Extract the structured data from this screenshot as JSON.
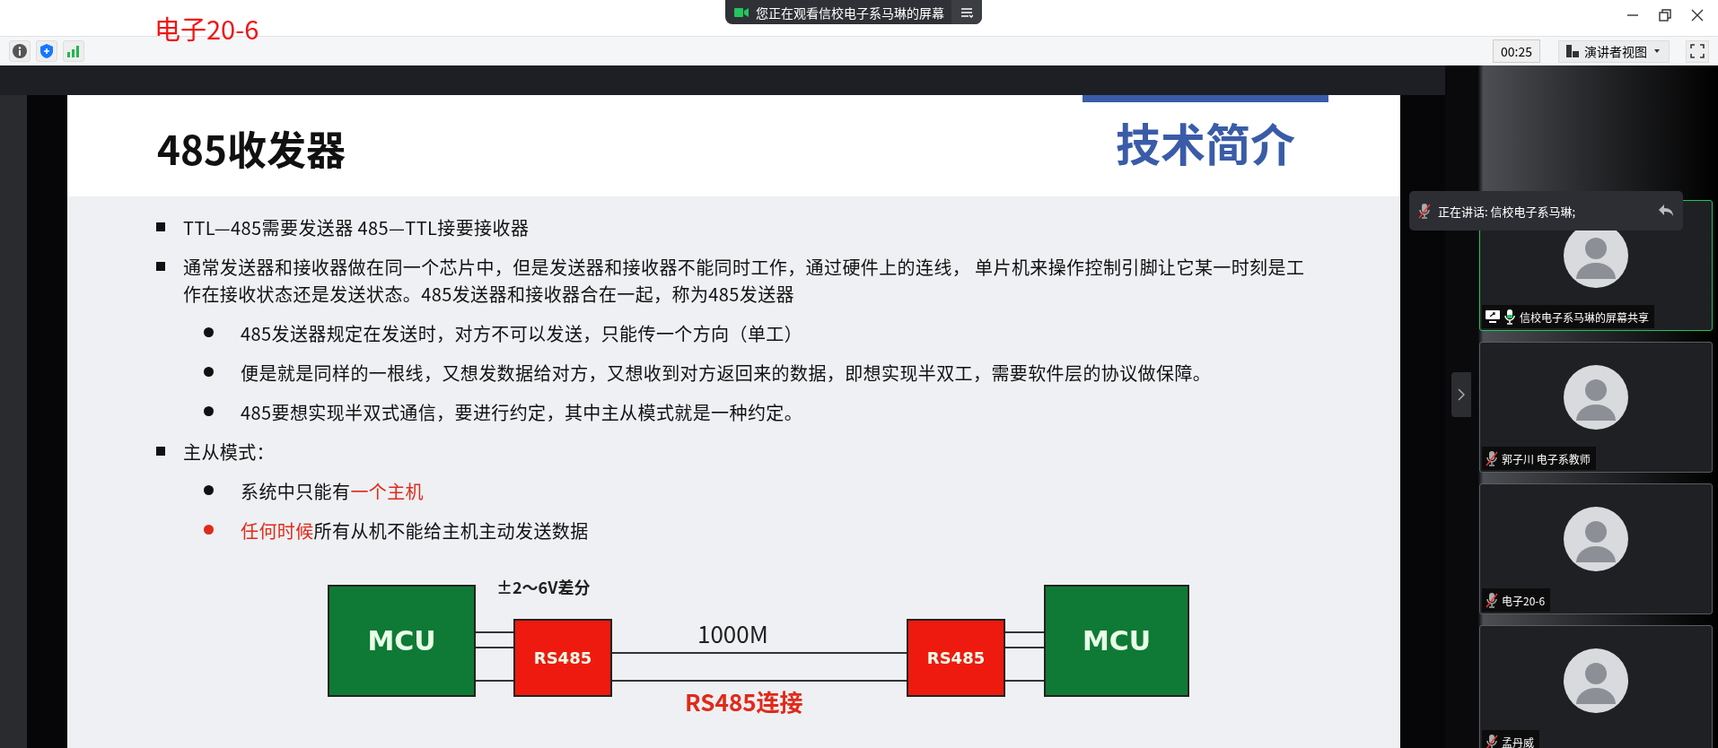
{
  "window": {
    "overlay_label": "电子20-6"
  },
  "share_notice": {
    "text": "您正在观看信校电子系马琳的屏幕"
  },
  "toolbar": {
    "timer": "00:25",
    "view_menu": "演讲者视图"
  },
  "slide": {
    "title": "485收发器",
    "section": "技术简介",
    "bullets": [
      {
        "segments": [
          {
            "text": "TTL—485需要发送器   485—TTL接要接收器",
            "highlight": false
          }
        ]
      },
      {
        "segments": [
          {
            "text": "通常发送器和接收器做在同一个芯片中，但是发送器和接收器不能同时工作，通过硬件上的连线， 单片机来操作控制引脚让它某一时刻是工作在接收状态还是发送状态。485发送器和接收器合在一起，称为485发送器",
            "highlight": false
          }
        ],
        "children": [
          {
            "marker_highlight": false,
            "segments": [
              {
                "text": " 485发送器规定在发送时，对方不可以发送，只能传一个方向（单工）",
                "highlight": false
              }
            ]
          },
          {
            "marker_highlight": false,
            "segments": [
              {
                "text": "便是就是同样的一根线，又想发数据给对方，又想收到对方返回来的数据，即想实现半双工，需要软件层的协议做保障。",
                "highlight": false
              }
            ]
          },
          {
            "marker_highlight": false,
            "segments": [
              {
                "text": "485要想实现半双式通信，要进行约定，其中主从模式就是一种约定。",
                "highlight": false
              }
            ]
          }
        ]
      },
      {
        "segments": [
          {
            "text": "主从模式：",
            "highlight": false
          }
        ],
        "children": [
          {
            "marker_highlight": false,
            "segments": [
              {
                "text": "系统中只能有",
                "highlight": false
              },
              {
                "text": "一个主机",
                "highlight": true
              }
            ]
          },
          {
            "marker_highlight": true,
            "segments": [
              {
                "text": "任何时候",
                "highlight": true
              },
              {
                "text": "所有从机不能给主机主动发送数据",
                "highlight": false
              }
            ]
          }
        ]
      }
    ],
    "diagram": {
      "voltage_label": "±2～6V差分",
      "distance_label": "1000M",
      "caption": "RS485连接",
      "nodes": [
        {
          "kind": "mcu",
          "label": "MCU"
        },
        {
          "kind": "transceiver",
          "label": "RS485"
        },
        {
          "kind": "transceiver",
          "label": "RS485"
        },
        {
          "kind": "mcu",
          "label": "MCU"
        }
      ]
    }
  },
  "speaking": {
    "text": "正在讲话: 信校电子系马琳;"
  },
  "participants": [
    {
      "name": "信校电子系马琳的屏幕共享",
      "muted": false,
      "sharing": true,
      "selected": true
    },
    {
      "name": "郭子川 电子系教师",
      "muted": true,
      "sharing": false,
      "selected": false
    },
    {
      "name": "电子20-6",
      "muted": true,
      "sharing": false,
      "selected": false
    },
    {
      "name": "孟丹威",
      "muted": true,
      "sharing": false,
      "selected": false
    }
  ]
}
